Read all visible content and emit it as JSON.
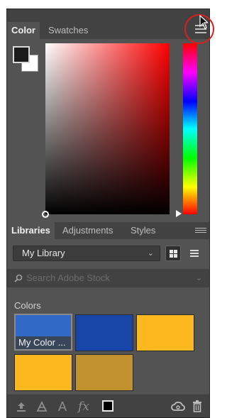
{
  "color_panel": {
    "tabs": [
      "Color",
      "Swatches"
    ],
    "active_tab": "Color",
    "foreground_color": "#1b1b1b",
    "background_color": "#ffffff"
  },
  "libraries_panel": {
    "tabs": [
      "Libraries",
      "Adjustments",
      "Styles"
    ],
    "active_tab": "Libraries",
    "library_select": "My Library",
    "search_placeholder": "Search Adobe Stock",
    "section_title": "Colors",
    "swatches": [
      {
        "label": "My Color ...",
        "color": "#3169c6"
      },
      {
        "label": "",
        "color": "#1846a8"
      },
      {
        "label": "",
        "color": "#fdb81f"
      },
      {
        "label": "",
        "color": "#fdb81f"
      },
      {
        "label": "",
        "color": "#c1922f"
      }
    ]
  },
  "toolbar": {
    "text_icon": "A",
    "fx_icon": "fx"
  },
  "colors": {
    "panel_bg": "#535353",
    "header_bg": "#424242",
    "annotation": "#d62020"
  }
}
